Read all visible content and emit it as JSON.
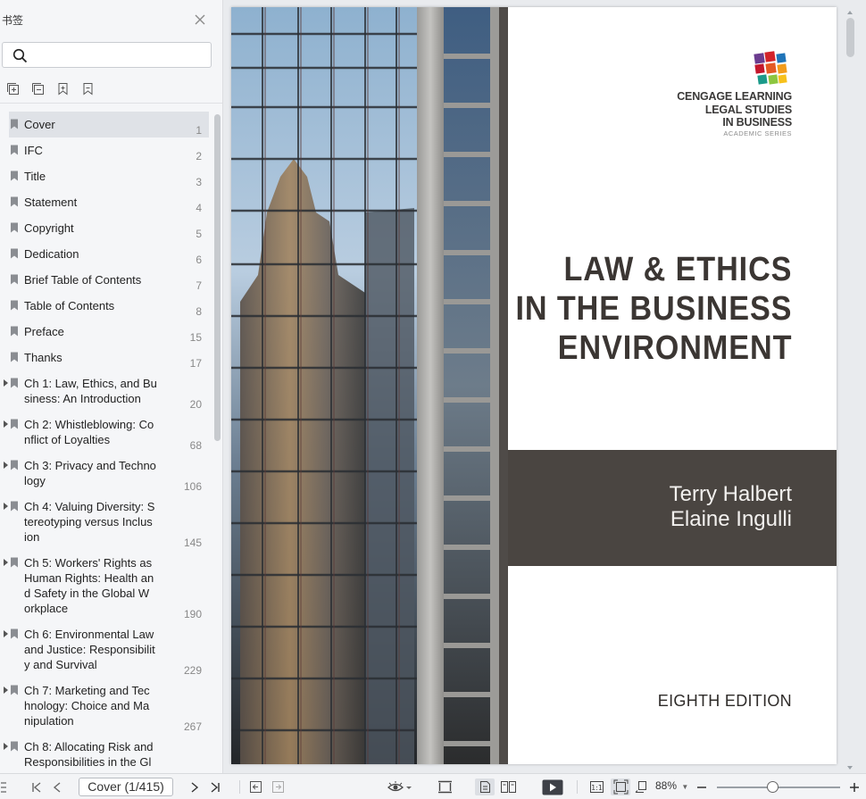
{
  "sidebar": {
    "title": "书签",
    "search": {
      "value": "",
      "placeholder": ""
    },
    "tools": [
      {
        "icon": "add-bookmark-icon"
      },
      {
        "icon": "remove-bookmark-icon"
      },
      {
        "icon": "bookmark-expand-icon"
      },
      {
        "icon": "bookmark-icon"
      }
    ],
    "items": [
      {
        "label": "Cover",
        "page": "1",
        "expandable": false,
        "selected": true
      },
      {
        "label": "IFC",
        "page": "2",
        "expandable": false
      },
      {
        "label": "Title",
        "page": "3",
        "expandable": false
      },
      {
        "label": "Statement",
        "page": "4",
        "expandable": false
      },
      {
        "label": "Copyright",
        "page": "5",
        "expandable": false
      },
      {
        "label": "Dedication",
        "page": "6",
        "expandable": false
      },
      {
        "label": "Brief Table of Contents",
        "page": "7",
        "expandable": false
      },
      {
        "label": "Table of Contents",
        "page": "8",
        "expandable": false
      },
      {
        "label": "Preface",
        "page": "15",
        "expandable": false
      },
      {
        "label": "Thanks",
        "page": "17",
        "expandable": false
      },
      {
        "label": "Ch 1: Law, Ethics, and Bu\nsiness: An Introduction",
        "page": "20",
        "expandable": true
      },
      {
        "label": "Ch 2: Whistleblowing: Co\nnflict of Loyalties",
        "page": "68",
        "expandable": true
      },
      {
        "label": "Ch 3: Privacy and Techno\nlogy",
        "page": "106",
        "expandable": true
      },
      {
        "label": "Ch 4: Valuing Diversity: S\ntereotyping versus Inclus\nion",
        "page": "145",
        "expandable": true
      },
      {
        "label": "Ch 5: Workers' Rights as\nHuman Rights: Health an\nd Safety in the Global W\norkplace",
        "page": "190",
        "expandable": true
      },
      {
        "label": "Ch 6: Environmental Law\nand Justice: Responsibilit\ny and Survival",
        "page": "229",
        "expandable": true
      },
      {
        "label": "Ch 7: Marketing and Tec\nhnology: Choice and Ma\nnipulation",
        "page": "267",
        "expandable": true
      },
      {
        "label": "Ch 8: Allocating Risk and\nResponsibilities in the Gl",
        "page": "",
        "expandable": true
      }
    ]
  },
  "cover": {
    "publisher_lines": [
      "CENGAGE LEARNING",
      "LEGAL STUDIES",
      "IN BUSINESS"
    ],
    "series": "ACADEMIC SERIES",
    "title_lines": [
      "LAW & ETHICS",
      "IN THE BUSINESS",
      "ENVIRONMENT"
    ],
    "authors": [
      "Terry Halbert",
      "Elaine Ingulli"
    ],
    "edition": "EIGHTH EDITION",
    "band_color": "#4a4541"
  },
  "statusbar": {
    "page_indicator": "Cover (1/415)",
    "zoom": "88%",
    "zoom_level": 0.5
  }
}
